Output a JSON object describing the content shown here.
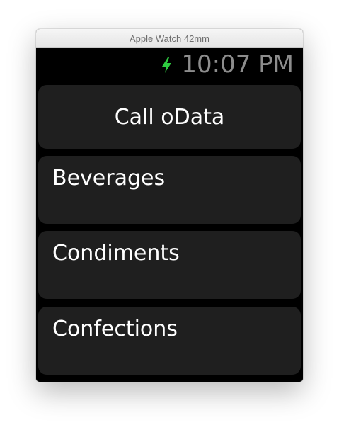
{
  "window": {
    "title": "Apple Watch 42mm"
  },
  "status": {
    "time": "10:07 PM",
    "charging_icon": "lightning-bolt-icon",
    "charging_color": "#2ecc40",
    "time_color": "#8d8d8d"
  },
  "actions": {
    "call_label": "Call oData"
  },
  "categories": [
    {
      "label": "Beverages"
    },
    {
      "label": "Condiments"
    },
    {
      "label": "Confections"
    }
  ],
  "colors": {
    "button_bg": "#1f1f1f",
    "screen_bg": "#000000",
    "text": "#ffffff"
  }
}
